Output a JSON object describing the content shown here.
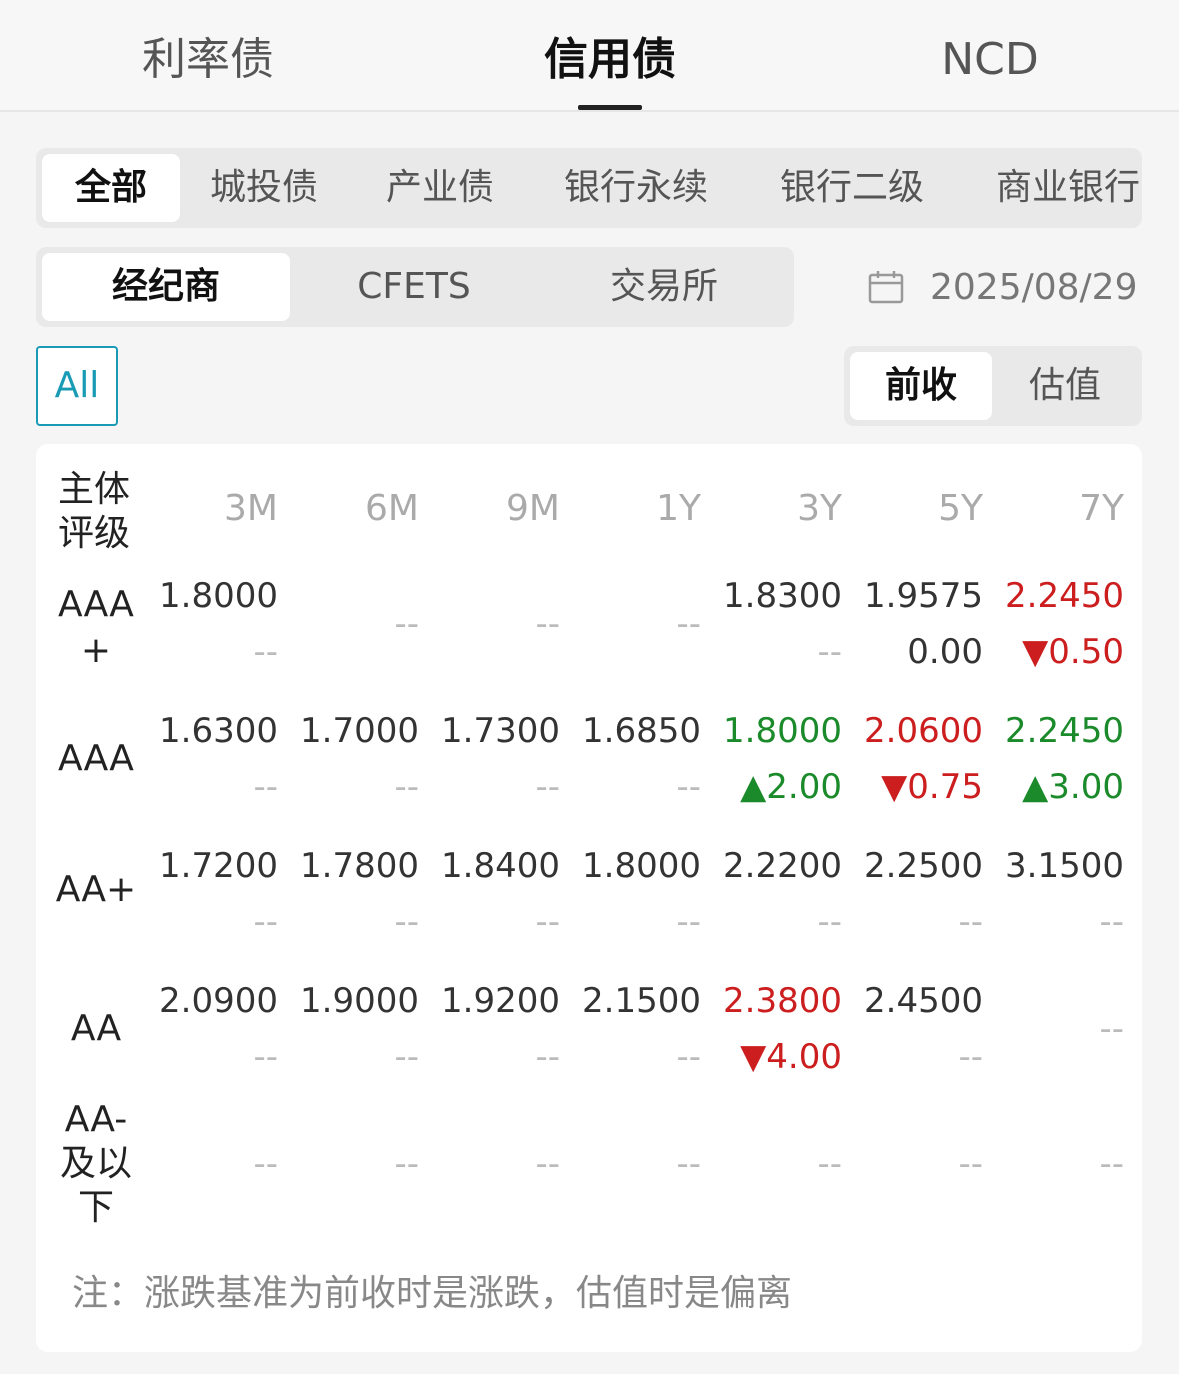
{
  "top_tabs": [
    "利率债",
    "信用债",
    "NCD"
  ],
  "categories": [
    "全部",
    "城投债",
    "产业债",
    "银行永续",
    "银行二级",
    "商业银行"
  ],
  "sources": [
    "经纪商",
    "CFETS",
    "交易所"
  ],
  "date": "2025/08/29",
  "filter_all": "All",
  "modes": [
    "前收",
    "估值"
  ],
  "table": {
    "rating_header": "主体评级",
    "columns": [
      "3M",
      "6M",
      "9M",
      "1Y",
      "3Y",
      "5Y",
      "7Y"
    ],
    "rows": [
      {
        "label": "AAA+",
        "cells": [
          {
            "value": "1.8000",
            "change": "--",
            "dir": "none"
          },
          {
            "value": "--",
            "single": true
          },
          {
            "value": "--",
            "single": true
          },
          {
            "value": "--",
            "single": true
          },
          {
            "value": "1.8300",
            "change": "--",
            "dir": "none"
          },
          {
            "value": "1.9575",
            "change": "0.00",
            "dir": "none"
          },
          {
            "value": "2.2450",
            "change": "▼0.50",
            "dir": "down"
          }
        ]
      },
      {
        "label": "AAA",
        "cells": [
          {
            "value": "1.6300",
            "change": "--",
            "dir": "none"
          },
          {
            "value": "1.7000",
            "change": "--",
            "dir": "none"
          },
          {
            "value": "1.7300",
            "change": "--",
            "dir": "none"
          },
          {
            "value": "1.6850",
            "change": "--",
            "dir": "none"
          },
          {
            "value": "1.8000",
            "change": "▲2.00",
            "dir": "up"
          },
          {
            "value": "2.0600",
            "change": "▼0.75",
            "dir": "down"
          },
          {
            "value": "2.2450",
            "change": "▲3.00",
            "dir": "up"
          }
        ]
      },
      {
        "label": "AA+",
        "cells": [
          {
            "value": "1.7200",
            "change": "--",
            "dir": "none"
          },
          {
            "value": "1.7800",
            "change": "--",
            "dir": "none"
          },
          {
            "value": "1.8400",
            "change": "--",
            "dir": "none"
          },
          {
            "value": "1.8000",
            "change": "--",
            "dir": "none"
          },
          {
            "value": "2.2200",
            "change": "--",
            "dir": "none"
          },
          {
            "value": "2.2500",
            "change": "--",
            "dir": "none"
          },
          {
            "value": "3.1500",
            "change": "--",
            "dir": "none"
          }
        ]
      },
      {
        "label": "AA",
        "cells": [
          {
            "value": "2.0900",
            "change": "--",
            "dir": "none"
          },
          {
            "value": "1.9000",
            "change": "--",
            "dir": "none"
          },
          {
            "value": "1.9200",
            "change": "--",
            "dir": "none"
          },
          {
            "value": "2.1500",
            "change": "--",
            "dir": "none"
          },
          {
            "value": "2.3800",
            "change": "▼4.00",
            "dir": "down"
          },
          {
            "value": "2.4500",
            "change": "--",
            "dir": "none"
          },
          {
            "value": "--",
            "single": true
          }
        ]
      },
      {
        "label": "AA-及以下",
        "cells": [
          {
            "value": "--",
            "single": true
          },
          {
            "value": "--",
            "single": true
          },
          {
            "value": "--",
            "single": true
          },
          {
            "value": "--",
            "single": true
          },
          {
            "value": "--",
            "single": true
          },
          {
            "value": "--",
            "single": true
          },
          {
            "value": "--",
            "single": true
          }
        ]
      }
    ]
  },
  "note": "注：涨跌基准为前收时是涨跌，估值时是偏离",
  "colors": {
    "up": "#1a8a2a",
    "down": "#cc1e1e",
    "accent": "#1a9bb5"
  }
}
